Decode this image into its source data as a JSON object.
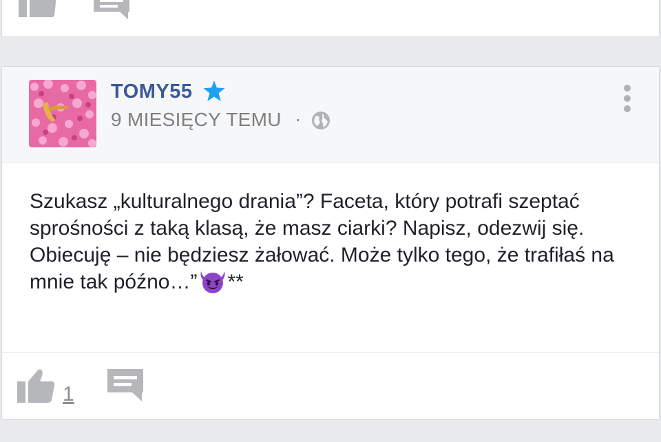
{
  "colors": {
    "page_background": "#e9eaed",
    "card_background": "#ffffff",
    "header_background": "#f6f7f9",
    "author_name": "#3b5998",
    "star": "#1da1f2",
    "muted_text": "#7f7f7f",
    "action_icons": "#b5b7bb",
    "body_text": "#1d2129"
  },
  "top_card": {
    "actions": {
      "like_icon": "thumbs-up-icon",
      "comment_icon": "comment-icon"
    }
  },
  "post": {
    "author": "TOMY55",
    "author_badge_icon": "star-icon",
    "timestamp": "9 MIESIĘCY TEMU",
    "separator": "·",
    "privacy_icon": "globe-icon",
    "menu_icon": "vertical-dots-icon",
    "avatar_icon": "avatar-image",
    "body": {
      "line1": "Szukasz „kulturalnego drania”? Faceta, który potrafi szeptać sprośności z taką klasą, że masz ciarki? Napisz, odezwij się.",
      "line2": "Obiecuję – nie będziesz żałować. Może tylko tego, że trafiłaś na mnie tak późno…”",
      "emoji_icon": "smiling-devil-emoji-icon",
      "tail": "**"
    },
    "footer": {
      "like_icon": "thumbs-up-icon",
      "like_count": "1",
      "comment_icon": "comment-icon"
    }
  }
}
